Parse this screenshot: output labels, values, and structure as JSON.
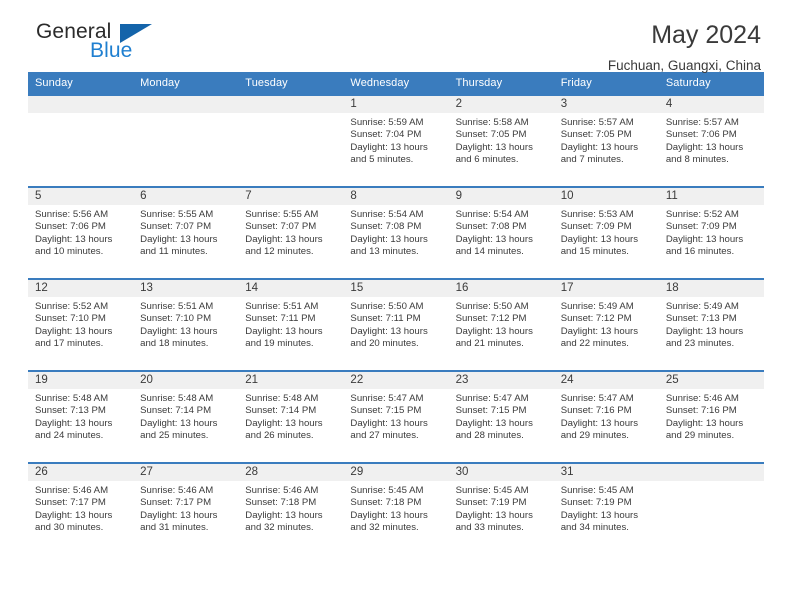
{
  "brand": {
    "name_top": "General",
    "name_bottom": "Blue",
    "triangle_color": "#1464aa",
    "blue_color": "#1f7fd0"
  },
  "header": {
    "title": "May 2024",
    "subtitle": "Fuchuan, Guangxi, China"
  },
  "theme": {
    "header_bg": "#3a7cbe",
    "daynum_bg": "#f0f0f0",
    "text": "#3b3b3b"
  },
  "weekdays": [
    "Sunday",
    "Monday",
    "Tuesday",
    "Wednesday",
    "Thursday",
    "Friday",
    "Saturday"
  ],
  "weeks": [
    [
      {
        "day": "",
        "sunrise": "",
        "sunset": "",
        "daylight_line1": "",
        "daylight_line2": ""
      },
      {
        "day": "",
        "sunrise": "",
        "sunset": "",
        "daylight_line1": "",
        "daylight_line2": ""
      },
      {
        "day": "",
        "sunrise": "",
        "sunset": "",
        "daylight_line1": "",
        "daylight_line2": ""
      },
      {
        "day": "1",
        "sunrise": "Sunrise: 5:59 AM",
        "sunset": "Sunset: 7:04 PM",
        "daylight_line1": "Daylight: 13 hours",
        "daylight_line2": "and 5 minutes."
      },
      {
        "day": "2",
        "sunrise": "Sunrise: 5:58 AM",
        "sunset": "Sunset: 7:05 PM",
        "daylight_line1": "Daylight: 13 hours",
        "daylight_line2": "and 6 minutes."
      },
      {
        "day": "3",
        "sunrise": "Sunrise: 5:57 AM",
        "sunset": "Sunset: 7:05 PM",
        "daylight_line1": "Daylight: 13 hours",
        "daylight_line2": "and 7 minutes."
      },
      {
        "day": "4",
        "sunrise": "Sunrise: 5:57 AM",
        "sunset": "Sunset: 7:06 PM",
        "daylight_line1": "Daylight: 13 hours",
        "daylight_line2": "and 8 minutes."
      }
    ],
    [
      {
        "day": "5",
        "sunrise": "Sunrise: 5:56 AM",
        "sunset": "Sunset: 7:06 PM",
        "daylight_line1": "Daylight: 13 hours",
        "daylight_line2": "and 10 minutes."
      },
      {
        "day": "6",
        "sunrise": "Sunrise: 5:55 AM",
        "sunset": "Sunset: 7:07 PM",
        "daylight_line1": "Daylight: 13 hours",
        "daylight_line2": "and 11 minutes."
      },
      {
        "day": "7",
        "sunrise": "Sunrise: 5:55 AM",
        "sunset": "Sunset: 7:07 PM",
        "daylight_line1": "Daylight: 13 hours",
        "daylight_line2": "and 12 minutes."
      },
      {
        "day": "8",
        "sunrise": "Sunrise: 5:54 AM",
        "sunset": "Sunset: 7:08 PM",
        "daylight_line1": "Daylight: 13 hours",
        "daylight_line2": "and 13 minutes."
      },
      {
        "day": "9",
        "sunrise": "Sunrise: 5:54 AM",
        "sunset": "Sunset: 7:08 PM",
        "daylight_line1": "Daylight: 13 hours",
        "daylight_line2": "and 14 minutes."
      },
      {
        "day": "10",
        "sunrise": "Sunrise: 5:53 AM",
        "sunset": "Sunset: 7:09 PM",
        "daylight_line1": "Daylight: 13 hours",
        "daylight_line2": "and 15 minutes."
      },
      {
        "day": "11",
        "sunrise": "Sunrise: 5:52 AM",
        "sunset": "Sunset: 7:09 PM",
        "daylight_line1": "Daylight: 13 hours",
        "daylight_line2": "and 16 minutes."
      }
    ],
    [
      {
        "day": "12",
        "sunrise": "Sunrise: 5:52 AM",
        "sunset": "Sunset: 7:10 PM",
        "daylight_line1": "Daylight: 13 hours",
        "daylight_line2": "and 17 minutes."
      },
      {
        "day": "13",
        "sunrise": "Sunrise: 5:51 AM",
        "sunset": "Sunset: 7:10 PM",
        "daylight_line1": "Daylight: 13 hours",
        "daylight_line2": "and 18 minutes."
      },
      {
        "day": "14",
        "sunrise": "Sunrise: 5:51 AM",
        "sunset": "Sunset: 7:11 PM",
        "daylight_line1": "Daylight: 13 hours",
        "daylight_line2": "and 19 minutes."
      },
      {
        "day": "15",
        "sunrise": "Sunrise: 5:50 AM",
        "sunset": "Sunset: 7:11 PM",
        "daylight_line1": "Daylight: 13 hours",
        "daylight_line2": "and 20 minutes."
      },
      {
        "day": "16",
        "sunrise": "Sunrise: 5:50 AM",
        "sunset": "Sunset: 7:12 PM",
        "daylight_line1": "Daylight: 13 hours",
        "daylight_line2": "and 21 minutes."
      },
      {
        "day": "17",
        "sunrise": "Sunrise: 5:49 AM",
        "sunset": "Sunset: 7:12 PM",
        "daylight_line1": "Daylight: 13 hours",
        "daylight_line2": "and 22 minutes."
      },
      {
        "day": "18",
        "sunrise": "Sunrise: 5:49 AM",
        "sunset": "Sunset: 7:13 PM",
        "daylight_line1": "Daylight: 13 hours",
        "daylight_line2": "and 23 minutes."
      }
    ],
    [
      {
        "day": "19",
        "sunrise": "Sunrise: 5:48 AM",
        "sunset": "Sunset: 7:13 PM",
        "daylight_line1": "Daylight: 13 hours",
        "daylight_line2": "and 24 minutes."
      },
      {
        "day": "20",
        "sunrise": "Sunrise: 5:48 AM",
        "sunset": "Sunset: 7:14 PM",
        "daylight_line1": "Daylight: 13 hours",
        "daylight_line2": "and 25 minutes."
      },
      {
        "day": "21",
        "sunrise": "Sunrise: 5:48 AM",
        "sunset": "Sunset: 7:14 PM",
        "daylight_line1": "Daylight: 13 hours",
        "daylight_line2": "and 26 minutes."
      },
      {
        "day": "22",
        "sunrise": "Sunrise: 5:47 AM",
        "sunset": "Sunset: 7:15 PM",
        "daylight_line1": "Daylight: 13 hours",
        "daylight_line2": "and 27 minutes."
      },
      {
        "day": "23",
        "sunrise": "Sunrise: 5:47 AM",
        "sunset": "Sunset: 7:15 PM",
        "daylight_line1": "Daylight: 13 hours",
        "daylight_line2": "and 28 minutes."
      },
      {
        "day": "24",
        "sunrise": "Sunrise: 5:47 AM",
        "sunset": "Sunset: 7:16 PM",
        "daylight_line1": "Daylight: 13 hours",
        "daylight_line2": "and 29 minutes."
      },
      {
        "day": "25",
        "sunrise": "Sunrise: 5:46 AM",
        "sunset": "Sunset: 7:16 PM",
        "daylight_line1": "Daylight: 13 hours",
        "daylight_line2": "and 29 minutes."
      }
    ],
    [
      {
        "day": "26",
        "sunrise": "Sunrise: 5:46 AM",
        "sunset": "Sunset: 7:17 PM",
        "daylight_line1": "Daylight: 13 hours",
        "daylight_line2": "and 30 minutes."
      },
      {
        "day": "27",
        "sunrise": "Sunrise: 5:46 AM",
        "sunset": "Sunset: 7:17 PM",
        "daylight_line1": "Daylight: 13 hours",
        "daylight_line2": "and 31 minutes."
      },
      {
        "day": "28",
        "sunrise": "Sunrise: 5:46 AM",
        "sunset": "Sunset: 7:18 PM",
        "daylight_line1": "Daylight: 13 hours",
        "daylight_line2": "and 32 minutes."
      },
      {
        "day": "29",
        "sunrise": "Sunrise: 5:45 AM",
        "sunset": "Sunset: 7:18 PM",
        "daylight_line1": "Daylight: 13 hours",
        "daylight_line2": "and 32 minutes."
      },
      {
        "day": "30",
        "sunrise": "Sunrise: 5:45 AM",
        "sunset": "Sunset: 7:19 PM",
        "daylight_line1": "Daylight: 13 hours",
        "daylight_line2": "and 33 minutes."
      },
      {
        "day": "31",
        "sunrise": "Sunrise: 5:45 AM",
        "sunset": "Sunset: 7:19 PM",
        "daylight_line1": "Daylight: 13 hours",
        "daylight_line2": "and 34 minutes."
      },
      {
        "day": "",
        "sunrise": "",
        "sunset": "",
        "daylight_line1": "",
        "daylight_line2": ""
      }
    ]
  ]
}
